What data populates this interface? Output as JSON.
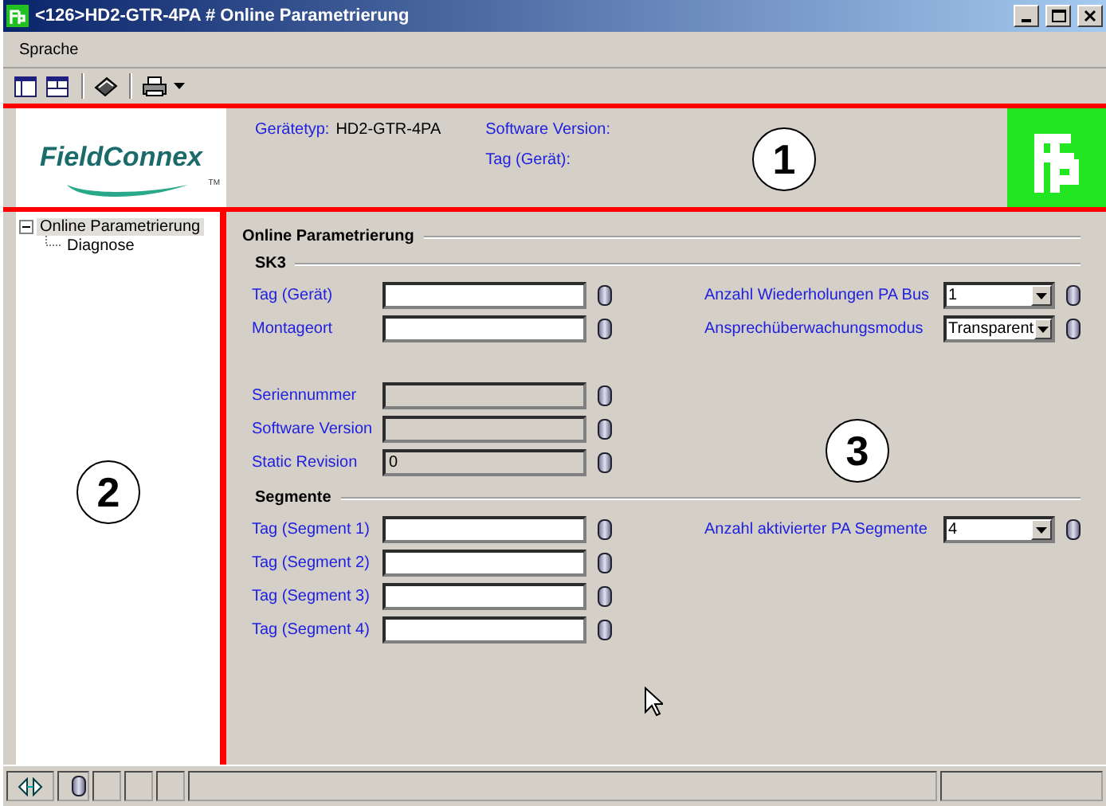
{
  "window": {
    "title": "<126>HD2-GTR-4PA # Online Parametrierung"
  },
  "menu": [
    {
      "label": "Sprache"
    }
  ],
  "header": {
    "logo_text": "FieldConnex",
    "logo_mark": "TM",
    "info": [
      {
        "label": "Gerätetyp:",
        "value": "HD2-GTR-4PA"
      },
      {
        "label": "Software Version:"
      },
      {
        "label": "Tag (Gerät):"
      }
    ]
  },
  "tree": [
    {
      "label": "Online Parametrierung",
      "selected": true,
      "expanded": true,
      "children": [
        {
          "label": "Diagnose",
          "selected": false
        }
      ]
    }
  ],
  "page_title": "Online Parametrierung",
  "sections": [
    {
      "title": "SK3",
      "left_groups": [
        [
          {
            "label": "Tag (Gerät)",
            "disabled": false
          },
          {
            "label": "Montageort",
            "disabled": false
          }
        ],
        [
          {
            "label": "Seriennummer",
            "disabled": true
          },
          {
            "label": "Software Version",
            "disabled": true
          },
          {
            "label": "Static Revision",
            "value": "0",
            "disabled": true
          }
        ]
      ],
      "right": [
        {
          "label": "Anzahl Wiederholungen PA Bus",
          "value": "1"
        },
        {
          "label": "Ansprechüberwachungsmodus",
          "value": "Transparent"
        }
      ]
    },
    {
      "title": "Segmente",
      "left_groups": [
        [
          {
            "label": "Tag (Segment 1)",
            "disabled": false
          },
          {
            "label": "Tag (Segment 2)",
            "disabled": false
          },
          {
            "label": "Tag (Segment 3)",
            "disabled": false
          },
          {
            "label": "Tag (Segment 4)",
            "disabled": false
          }
        ]
      ],
      "right": [
        {
          "label": "Anzahl aktivierter PA Segmente",
          "value": "4"
        }
      ]
    }
  ],
  "callouts": [
    "1",
    "2",
    "3"
  ]
}
